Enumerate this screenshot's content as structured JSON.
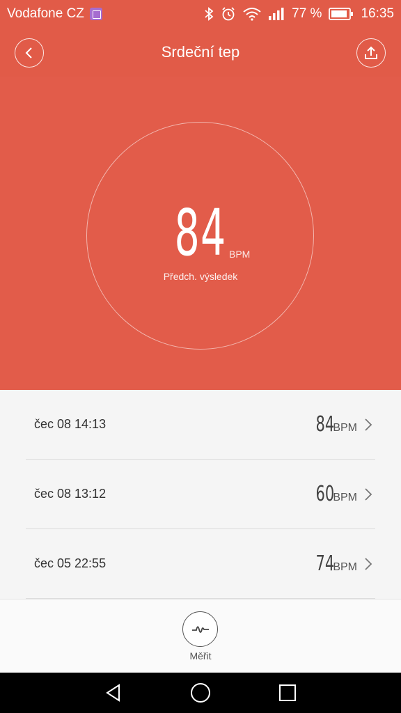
{
  "status_bar": {
    "carrier": "Vodafone CZ",
    "battery_percent": "77 %",
    "time": "16:35",
    "icons": [
      "image-icon",
      "bluetooth-icon",
      "alarm-icon",
      "wifi-icon",
      "signal-icon",
      "battery-icon"
    ]
  },
  "header": {
    "title": "Srdeční tep",
    "back_icon": "chevron-left-icon",
    "share_icon": "upload-icon"
  },
  "hero": {
    "value": "84",
    "unit": "BPM",
    "label": "Předch. výsledek"
  },
  "history": [
    {
      "date": "čec 08 14:13",
      "value": "84",
      "unit": "BPM"
    },
    {
      "date": "čec 08 13:12",
      "value": "60",
      "unit": "BPM"
    },
    {
      "date": "čec 05 22:55",
      "value": "74",
      "unit": "BPM"
    }
  ],
  "measure": {
    "label": "Měřit",
    "icon": "pulse-wave-icon"
  },
  "nav": {
    "icons": [
      "back-triangle-icon",
      "home-circle-icon",
      "recents-square-icon"
    ]
  },
  "colors": {
    "accent": "#e25c4a",
    "status_bar": "#e15b48"
  }
}
